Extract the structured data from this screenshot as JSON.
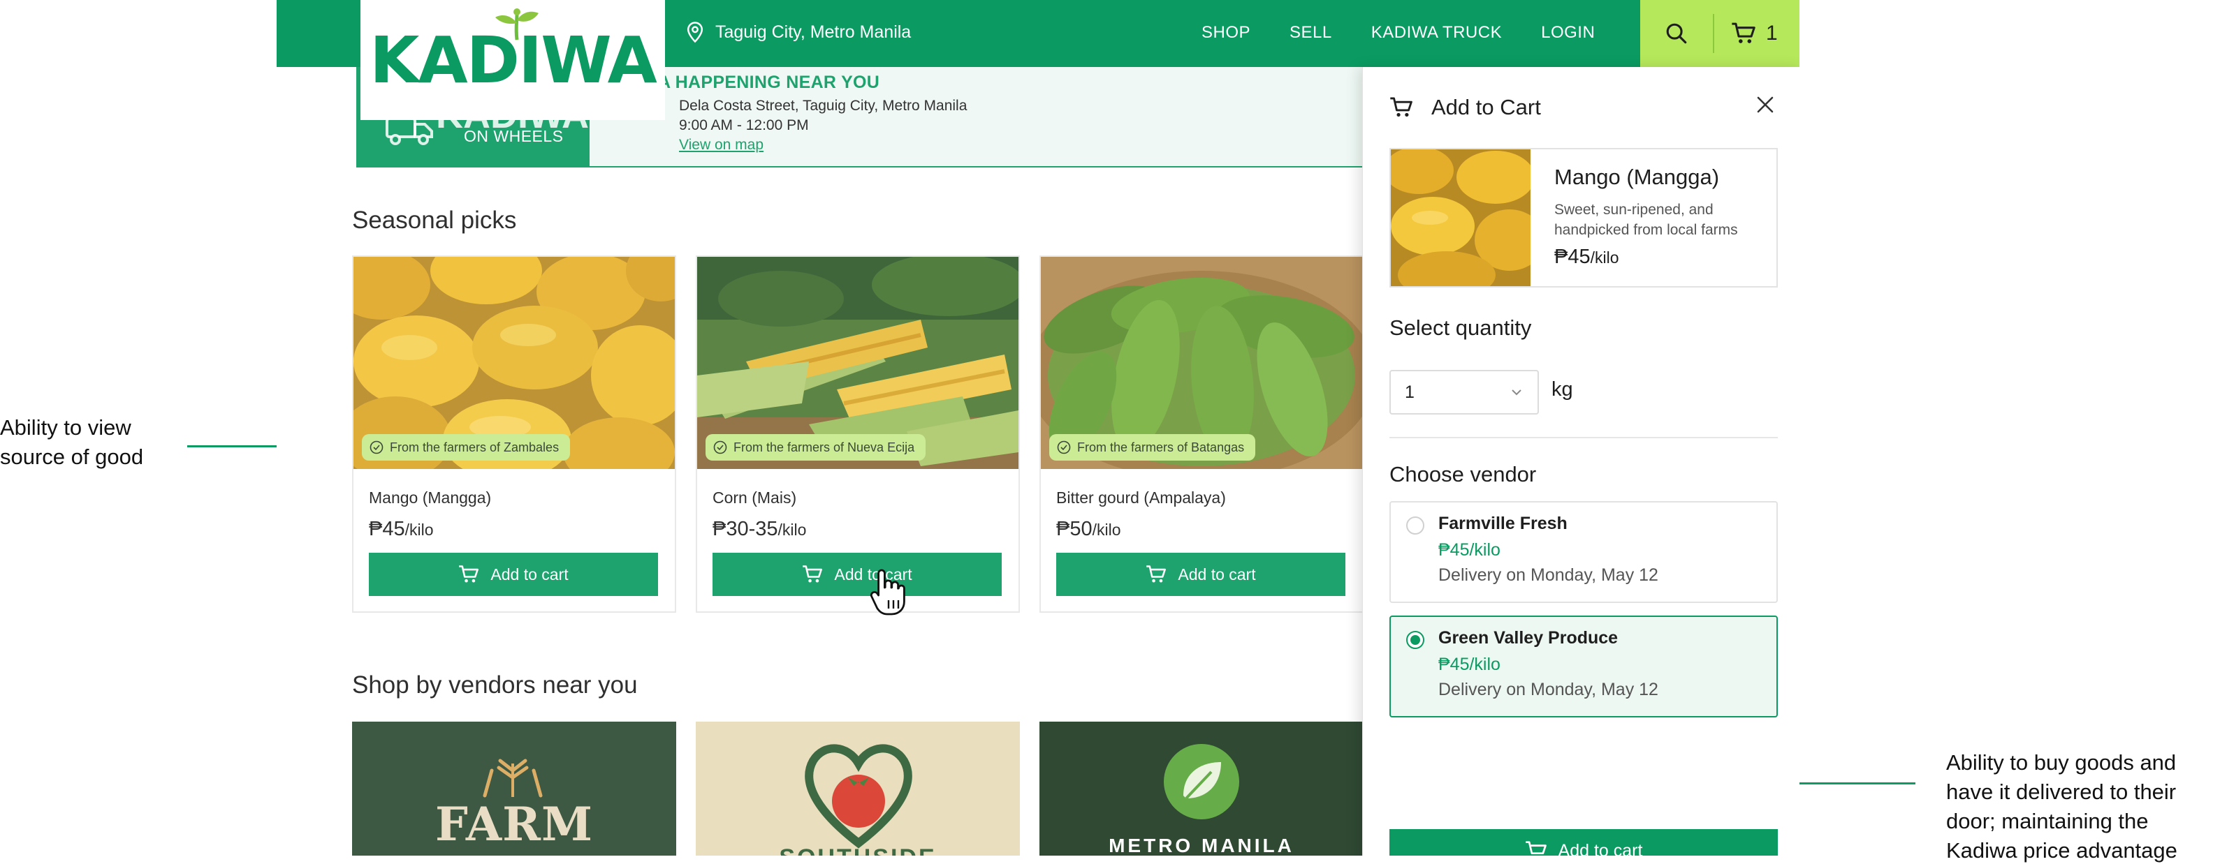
{
  "annotations": {
    "left": "Ability to view source of good",
    "right": "Ability to buy goods and have it delivered to their door; maintaining the Kadiwa price advantage"
  },
  "header": {
    "logo": "KADIWA",
    "location": "Taguig City, Metro Manila",
    "nav": [
      "SHOP",
      "SELL",
      "KADIWA TRUCK",
      "LOGIN"
    ],
    "cart_count": "1"
  },
  "banner": {
    "brand": "KADIWA",
    "sub": "ON WHEELS",
    "title": "A HAPPENING NEAR YOU",
    "address": "Dela Costa Street, Taguig City, Metro Manila",
    "time": "9:00 AM - 12:00 PM",
    "link": "View on map"
  },
  "seasonal": {
    "title": "Seasonal picks",
    "items": [
      {
        "name": "Mango (Mangga)",
        "price": "₱45",
        "unit": "/kilo",
        "source": "From the farmers of Zambales",
        "button": "Add to cart"
      },
      {
        "name": "Corn (Mais)",
        "price": "₱30-35",
        "unit": "/kilo",
        "source": "From the farmers of Nueva Ecija",
        "button": "Add to cart"
      },
      {
        "name": "Bitter gourd (Ampalaya)",
        "price": "₱50",
        "unit": "/kilo",
        "source": "From the farmers of Batangas",
        "button": "Add to cart"
      }
    ]
  },
  "vendors_section": {
    "title": "Shop by vendors near you",
    "vendors": [
      "FARM FRESH",
      "SOUTHSIDE",
      "METRO MANILA"
    ]
  },
  "panel": {
    "title": "Add to Cart",
    "product": {
      "name": "Mango (Mangga)",
      "desc": "Sweet, sun-ripened, and handpicked from local farms",
      "price": "₱45",
      "unit": "/kilo"
    },
    "qty_label": "Select quantity",
    "qty_value": "1",
    "qty_unit": "kg",
    "vendor_label": "Choose vendor",
    "vendor_options": [
      {
        "name": "Farmville Fresh",
        "price": "₱45/kilo",
        "delivery": "Delivery on Monday, May 12",
        "selected": false
      },
      {
        "name": "Green Valley Produce",
        "price": "₱45/kilo",
        "delivery": "Delivery on Monday, May 12",
        "selected": true
      }
    ],
    "button": "Add to cart"
  },
  "colors": {
    "brand": "#0b9b62",
    "accent": "#b6e85b",
    "badge": "#c8ea8c"
  }
}
